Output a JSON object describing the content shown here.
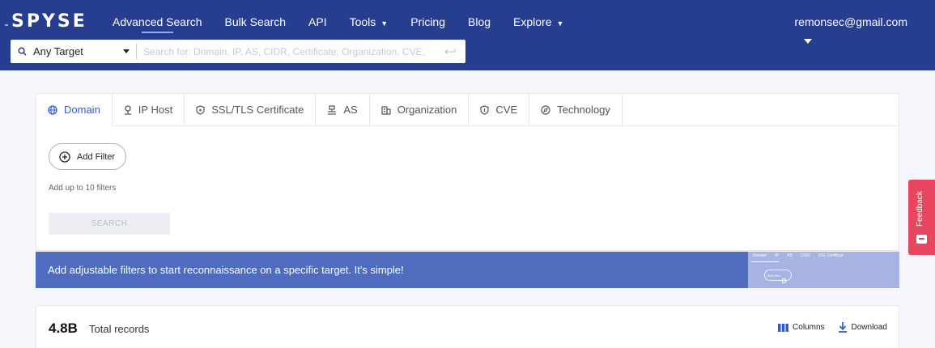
{
  "header": {
    "logo": "SPYSE",
    "nav": [
      {
        "label": "Advanced Search",
        "active": true
      },
      {
        "label": "Bulk Search"
      },
      {
        "label": "API"
      },
      {
        "label": "Tools",
        "dropdown": true
      },
      {
        "label": "Pricing"
      },
      {
        "label": "Blog"
      },
      {
        "label": "Explore",
        "dropdown": true
      }
    ],
    "user_email": "remonsec@gmail.com"
  },
  "search": {
    "target": "Any Target",
    "placeholder": "Search for: Domain, IP, AS, CIDR, Certificate, Organization, CVE, Te..."
  },
  "tabs": [
    {
      "label": "Domain",
      "icon": "globe-icon",
      "active": true
    },
    {
      "label": "IP Host",
      "icon": "pin-icon"
    },
    {
      "label": "SSL/TLS Certificate",
      "icon": "shield-icon"
    },
    {
      "label": "AS",
      "icon": "network-icon"
    },
    {
      "label": "Organization",
      "icon": "building-icon"
    },
    {
      "label": "CVE",
      "icon": "shield-icon"
    },
    {
      "label": "Technology",
      "icon": "compass-icon"
    }
  ],
  "filters": {
    "add_label": "Add Filter",
    "hint": "Add up to 10 filters",
    "search_label": "SEARCH"
  },
  "banner": {
    "text": "Add adjustable filters to start reconnaissance on a specific target. It's simple!",
    "preview": {
      "tabs": [
        "Domain",
        "IP",
        "AS",
        "CIDR",
        "SSL Certificat"
      ],
      "add_filter": "Add filter"
    }
  },
  "records": {
    "count": "4.8B",
    "label": "Total records",
    "columns_label": "Columns",
    "download_label": "Download"
  },
  "feedback": {
    "label": "Feedback"
  },
  "colors": {
    "header_bg": "#273d8f",
    "accent": "#2e5bd9",
    "banner_bg": "#4f6cbf",
    "feedback_bg": "#e8455f"
  }
}
